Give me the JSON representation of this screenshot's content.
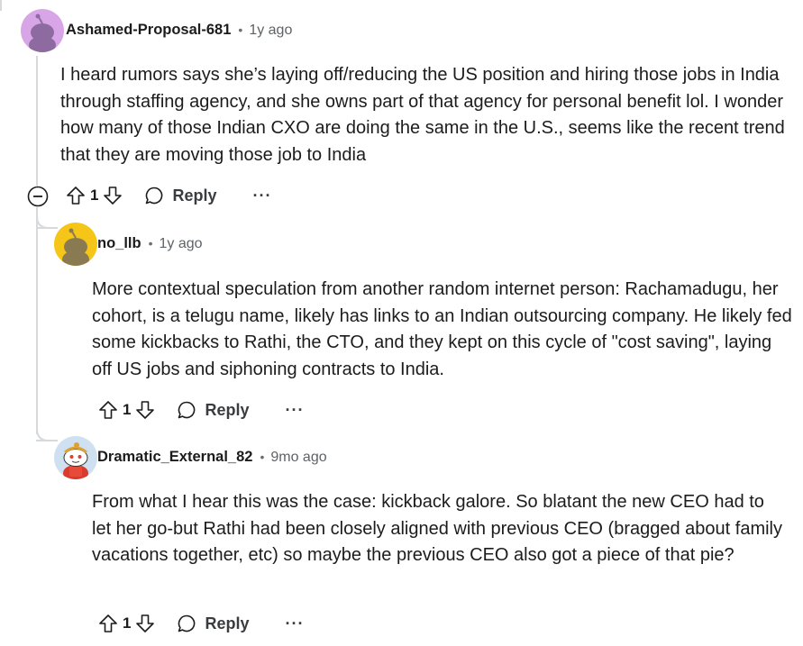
{
  "comments": [
    {
      "author": "Ashamed-Proposal-681",
      "separator": "•",
      "time": "1y ago",
      "text": "I heard rumors says she’s laying off/reducing the US position and hiring those jobs in India through staffing agency, and she owns part of that agency for personal benefit lol. I wonder how many of those Indian CXO are doing the same in the U.S., seems like the recent trend that they are moving those job to India",
      "votes": "1",
      "reply_label": "Reply",
      "more_label": "···"
    },
    {
      "author": "no_llb",
      "separator": "•",
      "time": "1y ago",
      "text": "More contextual speculation from another random internet person: Rachamadugu, her cohort, is a telugu name, likely has links to an Indian outsourcing company. He likely fed some kickbacks to Rathi, the CTO, and they kept on this cycle of \"cost saving\", laying off US jobs and siphoning contracts to India.",
      "votes": "1",
      "reply_label": "Reply",
      "more_label": "···"
    },
    {
      "author": "Dramatic_External_82",
      "separator": "•",
      "time": "9mo ago",
      "text": "From what I hear this was the case: kickback galore. So blatant the new CEO had to let her go-but Rathi had been closely aligned with previous CEO (bragged about family vacations together, etc) so maybe the previous CEO also got a piece of that pie?",
      "votes": "1",
      "reply_label": "Reply",
      "more_label": "···"
    }
  ],
  "colors": {
    "avatar1_bg": "#d8a6e6",
    "avatar2_bg": "#f5c518",
    "avatar3_bg": "#cfe0f0",
    "thread_line": "#d6dadc"
  }
}
